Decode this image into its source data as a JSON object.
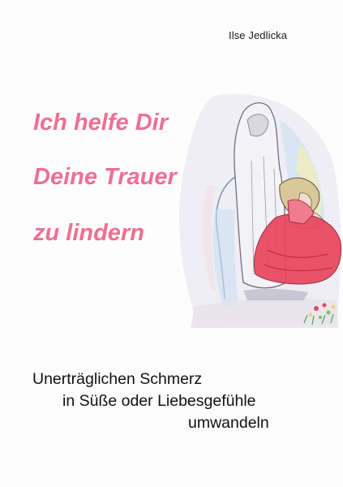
{
  "cover": {
    "author": "Ilse Jedlicka",
    "title_lines": [
      "Ich helfe Dir",
      "Deine Trauer",
      "zu lindern"
    ],
    "subtitle_lines": [
      "Unerträglichen Schmerz",
      "in Süße oder Liebesgefühle",
      "umwandeln"
    ],
    "illustration": "mourning-figure-with-ghost-drawing",
    "colors": {
      "title": "#ee6f93",
      "text": "#111111",
      "dress": "#e8465e"
    }
  }
}
